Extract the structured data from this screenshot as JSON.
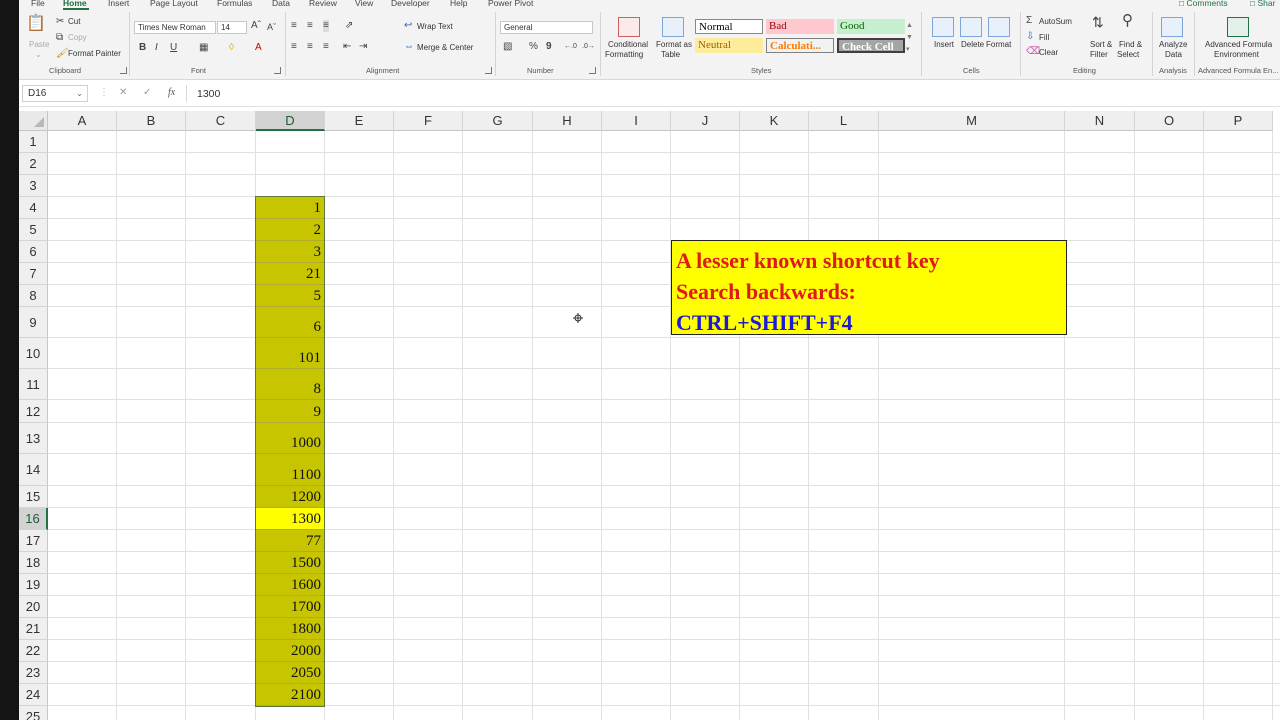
{
  "ribbon": {
    "tabs": [
      "File",
      "Home",
      "Insert",
      "Page Layout",
      "Formulas",
      "Data",
      "Review",
      "View",
      "Developer",
      "Help",
      "Power Pivot"
    ],
    "active_tab": "Home",
    "right_buttons": [
      "Comments",
      "Shar"
    ],
    "clipboard": {
      "paste": "Paste",
      "cut": "Cut",
      "copy": "Copy",
      "format_painter": "Format Painter",
      "label": "Clipboard"
    },
    "font": {
      "name": "Times New Roman",
      "size": "14",
      "bold": "B",
      "italic": "I",
      "underline": "U",
      "label": "Font"
    },
    "alignment": {
      "wrap_text": "Wrap Text",
      "merge_center": "Merge & Center",
      "label": "Alignment"
    },
    "number": {
      "format": "General",
      "percent": "%",
      "comma": "9",
      "label": "Number"
    },
    "styles": {
      "conditional": [
        "Conditional",
        "Formatting"
      ],
      "format_as": [
        "Format as",
        "Table"
      ],
      "normal": "Normal",
      "bad": "Bad",
      "good": "Good",
      "neutral": "Neutral",
      "calculation": "Calculati...",
      "check_cell": "Check Cell",
      "label": "Styles"
    },
    "cells": {
      "insert": "Insert",
      "delete": "Delete",
      "format": "Format",
      "label": "Cells"
    },
    "editing": {
      "autosum": "AutoSum",
      "fill": "Fill",
      "clear": "Clear",
      "sort": [
        "Sort &",
        "Filter"
      ],
      "find": [
        "Find &",
        "Select"
      ],
      "label": "Editing"
    },
    "analysis": {
      "analyze": [
        "Analyze",
        "Data"
      ],
      "label": "Analysis"
    },
    "advanced": {
      "name": [
        "Advanced Formula",
        "Environment"
      ],
      "label": "Advanced Formula En..."
    }
  },
  "formula_bar": {
    "name_box": "D16",
    "fx": "fx",
    "value": "1300"
  },
  "columns": [
    "A",
    "B",
    "C",
    "D",
    "E",
    "F",
    "G",
    "H",
    "I",
    "J",
    "K",
    "L",
    "M",
    "N",
    "O",
    "P"
  ],
  "selected_column": "D",
  "rows": [
    "1",
    "2",
    "3",
    "4",
    "5",
    "6",
    "7",
    "8",
    "9",
    "10",
    "11",
    "12",
    "13",
    "14",
    "15",
    "16",
    "17",
    "18",
    "19",
    "20",
    "21",
    "22",
    "23",
    "24",
    "25"
  ],
  "active_row": "16",
  "column_d_values": [
    "1",
    "2",
    "3",
    "21",
    "5",
    "6",
    "101",
    "8",
    "9",
    "1000",
    "1100",
    "1200",
    "1300",
    "77",
    "1500",
    "1600",
    "1700",
    "1800",
    "2000",
    "2050",
    "2100"
  ],
  "note": {
    "line1": "A lesser known shortcut key",
    "line2": "Search backwards:",
    "line3": "CTRL+SHIFT+F4"
  },
  "colors": {
    "accent": "#217346",
    "fill_olive": "#c7c400",
    "fill_yellow": "#ffff00",
    "note_red": "#e0191b",
    "note_blue": "#1b1bd6"
  }
}
